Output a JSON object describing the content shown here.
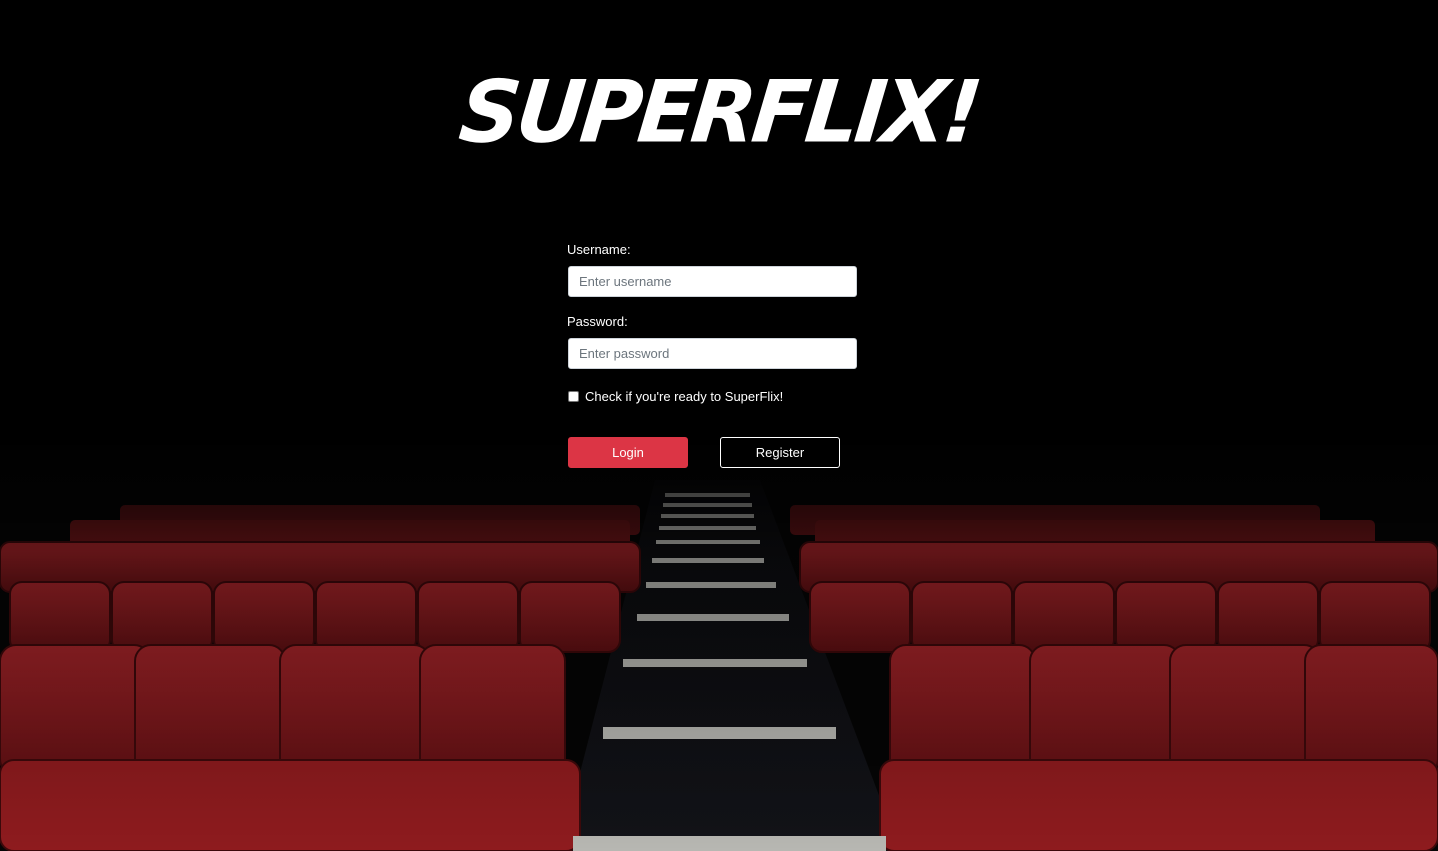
{
  "logo": {
    "text": "SUPERFLIX!"
  },
  "login_form": {
    "username_label": "Username:",
    "username_placeholder": "Enter username",
    "username_value": "",
    "password_label": "Password:",
    "password_placeholder": "Enter password",
    "password_value": "",
    "checkbox_label": "Check if you're ready to SuperFlix!",
    "checkbox_checked": false,
    "login_button": "Login",
    "register_button": "Register"
  },
  "colors": {
    "background": "#000000",
    "seat_red": "#8e1b1e",
    "login_button": "#dc3545",
    "text": "#ffffff"
  }
}
